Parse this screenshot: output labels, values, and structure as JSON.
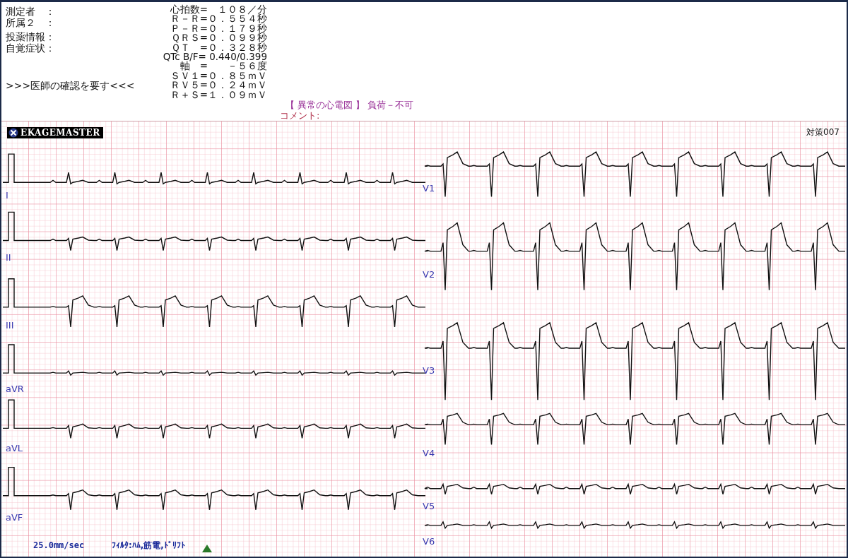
{
  "patient_fields": [
    "測定者　：",
    "所属２　：",
    "投薬情報：",
    "自覚症状："
  ],
  "warning": ">>>医師の確認を要す<<<",
  "measurements": [
    "心拍数=　１０８／分",
    "Ｒ－Ｒ=０．５５４秒",
    "Ｐ－Ｒ=０．１７９秒",
    "ＱＲＳ=０．０９９秒",
    "ＱＴ　=０．３２８秒",
    "QTc B/F= 0.440/0.399",
    "軸　=　　－５６度",
    "ＳＶ１=０．８５ｍＶ",
    "ＲＶ５=０．２４ｍＶ",
    "Ｒ＋Ｓ=１．０９ｍＶ"
  ],
  "diagnosis": "【 異常の心電図 】 負荷－不可",
  "comment_label": "コメント:",
  "ecg": {
    "logo": "EKAGEMASTER",
    "tag": "対策007",
    "limb_leads": [
      {
        "label": "I"
      },
      {
        "label": "II"
      },
      {
        "label": "III"
      },
      {
        "label": "aVR"
      },
      {
        "label": "aVL"
      },
      {
        "label": "aVF"
      }
    ],
    "chest_leads": [
      {
        "label": "V1"
      },
      {
        "label": "V2"
      },
      {
        "label": "V3"
      },
      {
        "label": "V4"
      },
      {
        "label": "V5"
      },
      {
        "label": "V6"
      }
    ],
    "paper_speed": "25.0mm/sec",
    "filter": "ﾌｨﾙﾀ:ﾊﾑ,筋電,ﾄﾞﾘﾌﾄ"
  }
}
